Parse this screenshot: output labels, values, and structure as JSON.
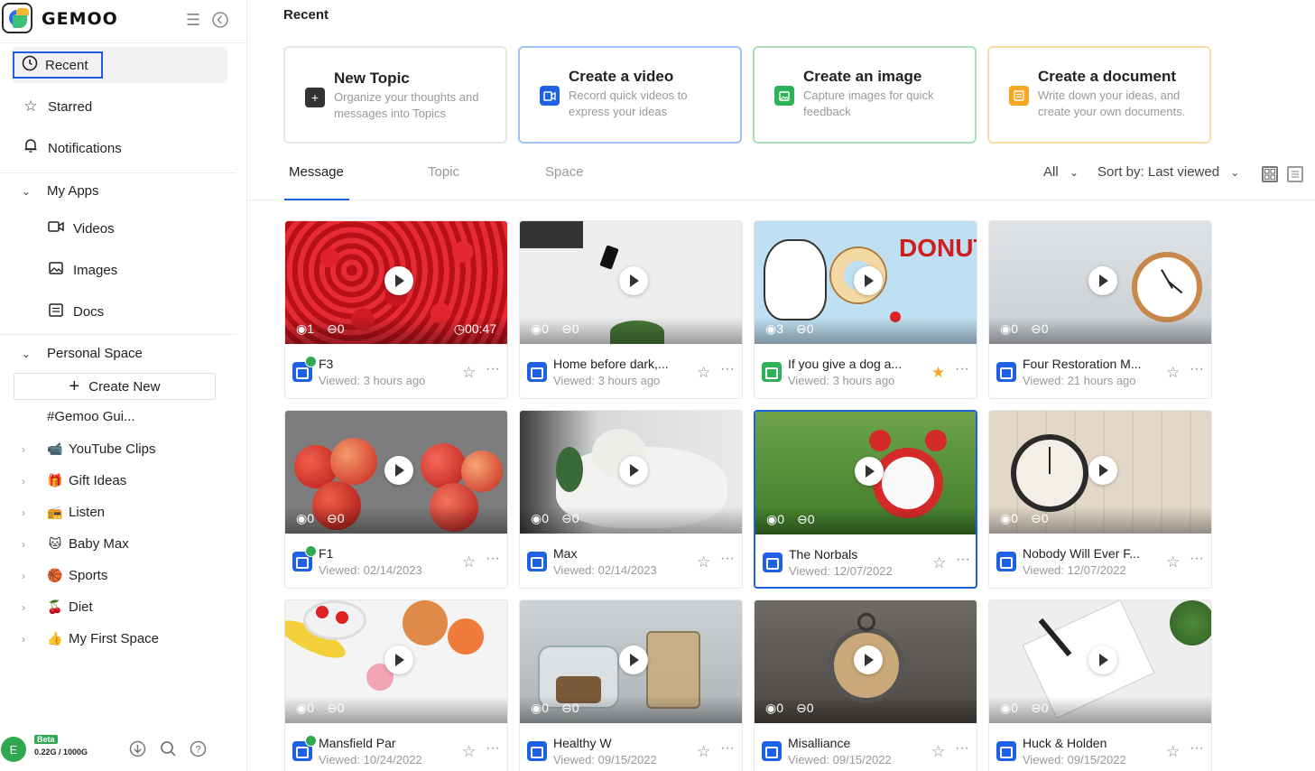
{
  "brand": "GEMOO",
  "sidebar": {
    "recent": "Recent",
    "starred": "Starred",
    "notifications": "Notifications",
    "my_apps": "My Apps",
    "apps": [
      "Videos",
      "Images",
      "Docs"
    ],
    "personal_space": "Personal Space",
    "create_new": "Create New",
    "gemoo_gui": "#Gemoo Gui...",
    "spaces": [
      "YouTube Clips",
      "Gift Ideas",
      "Listen",
      "Baby Max",
      "Sports",
      "Diet",
      "My First Space"
    ],
    "space_emojis": [
      "📹",
      "🎁",
      "📻",
      "🐱",
      "🏀",
      "🍒",
      "👍"
    ]
  },
  "footer": {
    "avatar": "E",
    "beta": "Beta",
    "quota": "0.22G / 1000G"
  },
  "main": {
    "title": "Recent",
    "create_cards": [
      {
        "title": "New Topic",
        "desc": "Organize your thoughts and messages into Topics",
        "color": "#333333",
        "icon": "plus-icon"
      },
      {
        "title": "Create a video",
        "desc": "Record quick videos to express your ideas",
        "color": "#1e61e6",
        "icon": "video-icon"
      },
      {
        "title": "Create an image",
        "desc": "Capture images for quick feedback",
        "color": "#2fb257",
        "icon": "image-icon"
      },
      {
        "title": "Create a document",
        "desc": "Write down your ideas, and create your own documents.",
        "color": "#f5a623",
        "icon": "document-icon"
      }
    ],
    "tabs": [
      "Message",
      "Topic",
      "Space"
    ],
    "filter_all": "All",
    "sort_label": "Sort by: Last viewed"
  },
  "cards": [
    {
      "title": "F3",
      "viewed": "Viewed: 3 hours ago",
      "views": "1",
      "comments": "0",
      "duration": "00:47",
      "type": "video",
      "badge": true,
      "fav": false
    },
    {
      "title": "Home before dark,...",
      "viewed": "Viewed: 3 hours ago",
      "views": "0",
      "comments": "0",
      "duration": "",
      "type": "video",
      "badge": false,
      "fav": false
    },
    {
      "title": "If you give a dog a...",
      "viewed": "Viewed: 3 hours ago",
      "views": "3",
      "comments": "0",
      "duration": "",
      "type": "image",
      "badge": false,
      "fav": true
    },
    {
      "title": "Four Restoration M...",
      "viewed": "Viewed: 21 hours ago",
      "views": "0",
      "comments": "0",
      "duration": "",
      "type": "video",
      "badge": false,
      "fav": false
    },
    {
      "title": "F1",
      "viewed": "Viewed: 02/14/2023",
      "views": "0",
      "comments": "0",
      "duration": "",
      "type": "video",
      "badge": true,
      "fav": false
    },
    {
      "title": "Max",
      "viewed": "Viewed: 02/14/2023",
      "views": "0",
      "comments": "0",
      "duration": "",
      "type": "video",
      "badge": false,
      "fav": false
    },
    {
      "title": "The Norbals",
      "viewed": "Viewed: 12/07/2022",
      "views": "0",
      "comments": "0",
      "duration": "",
      "type": "video",
      "badge": false,
      "fav": false
    },
    {
      "title": "Nobody Will Ever F...",
      "viewed": "Viewed: 12/07/2022",
      "views": "0",
      "comments": "0",
      "duration": "",
      "type": "video",
      "badge": false,
      "fav": false
    },
    {
      "title": "Mansfield Par",
      "viewed": "Viewed: 10/24/2022",
      "views": "0",
      "comments": "0",
      "duration": "",
      "type": "video",
      "badge": true,
      "fav": false
    },
    {
      "title": "Healthy W",
      "viewed": "Viewed: 09/15/2022",
      "views": "0",
      "comments": "0",
      "duration": "",
      "type": "video",
      "badge": false,
      "fav": false
    },
    {
      "title": "Misalliance",
      "viewed": "Viewed: 09/15/2022",
      "views": "0",
      "comments": "0",
      "duration": "",
      "type": "video",
      "badge": false,
      "fav": false
    },
    {
      "title": "Huck & Holden",
      "viewed": "Viewed: 09/15/2022",
      "views": "0",
      "comments": "0",
      "duration": "",
      "type": "video",
      "badge": false,
      "fav": false
    }
  ],
  "thumb_art": {
    "donut_text": "DONUT"
  }
}
